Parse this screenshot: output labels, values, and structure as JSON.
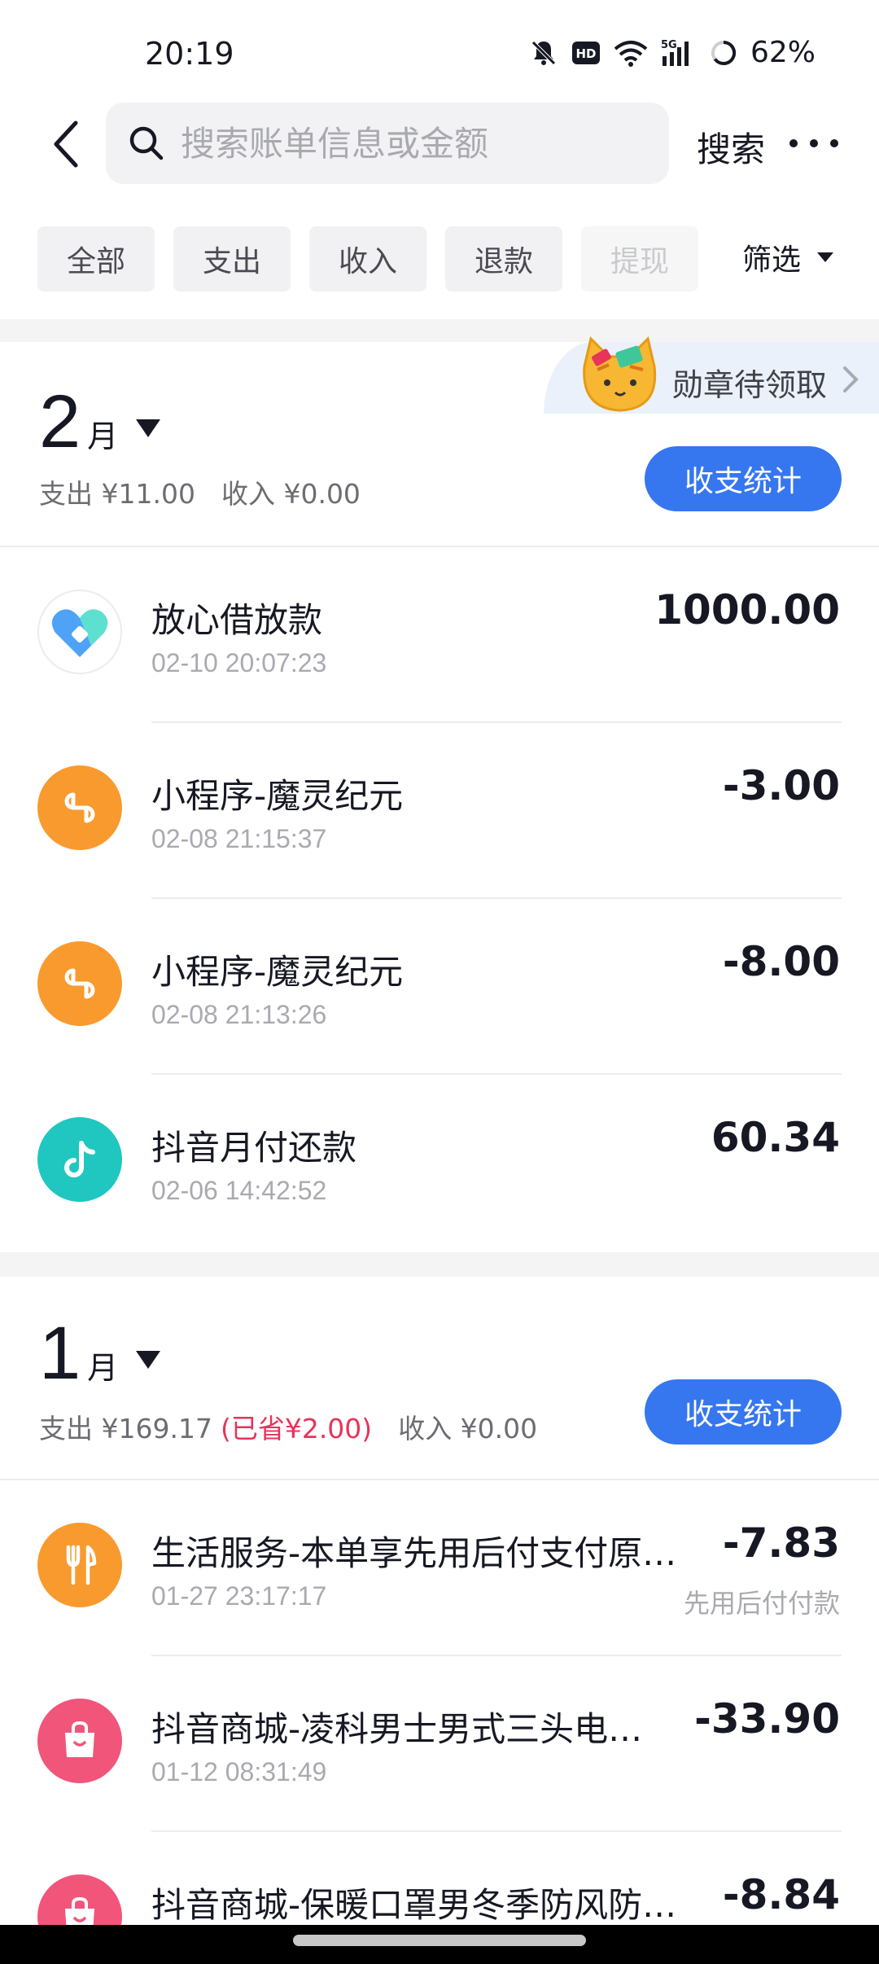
{
  "status_bar": {
    "time": "20:19",
    "battery": "62%",
    "icons": [
      "mute-icon",
      "hd-icon",
      "wifi-icon",
      "5g-signal-icon",
      "battery-icon"
    ]
  },
  "header": {
    "search_placeholder": "搜索账单信息或金额",
    "search_button": "搜索"
  },
  "filters": {
    "tabs": [
      {
        "label": "全部"
      },
      {
        "label": "支出"
      },
      {
        "label": "收入"
      },
      {
        "label": "退款"
      },
      {
        "label": "提现"
      }
    ],
    "more_label": "筛选"
  },
  "badge": {
    "label": "勋章待领取"
  },
  "months": [
    {
      "num": "2",
      "unit": "月",
      "expense": "支出 ¥11.00",
      "saved": "",
      "income": "收入 ¥0.00",
      "stats_button": "收支统计",
      "transactions": [
        {
          "title": "放心借放款",
          "time": "02-10 20:07:23",
          "amount": "1000.00",
          "sub": "",
          "icon": "loan-heart-icon"
        },
        {
          "title": "小程序-魔灵纪元",
          "time": "02-08 21:15:37",
          "amount": "-3.00",
          "sub": "",
          "icon": "mini-program-icon"
        },
        {
          "title": "小程序-魔灵纪元",
          "time": "02-08 21:13:26",
          "amount": "-8.00",
          "sub": "",
          "icon": "mini-program-icon"
        },
        {
          "title": "抖音月付还款",
          "time": "02-06 14:42:52",
          "amount": "60.34",
          "sub": "",
          "icon": "douyin-icon"
        }
      ]
    },
    {
      "num": "1",
      "unit": "月",
      "expense": "支出 ¥169.17",
      "saved": "(已省¥2.00)",
      "income": "收入 ¥0.00",
      "stats_button": "收支统计",
      "transactions": [
        {
          "title": "生活服务-本单享先用后付支付原…",
          "time": "01-27 23:17:17",
          "amount": "-7.83",
          "sub": "先用后付付款",
          "icon": "utensils-icon"
        },
        {
          "title": "抖音商城-凌科男士男式三头电…",
          "time": "01-12 08:31:49",
          "amount": "-33.90",
          "sub": "",
          "icon": "shopping-bag-icon"
        },
        {
          "title": "抖音商城-保暖口罩男冬季防风防…",
          "time": "",
          "amount": "-8.84",
          "sub": "",
          "icon": "shopping-bag-icon"
        }
      ]
    }
  ],
  "colors": {
    "accent": "#3677ef",
    "saved": "#e8335a",
    "mini_program": "#f99a2e",
    "douyin": "#1fc7c0",
    "shop": "#f2557a"
  }
}
